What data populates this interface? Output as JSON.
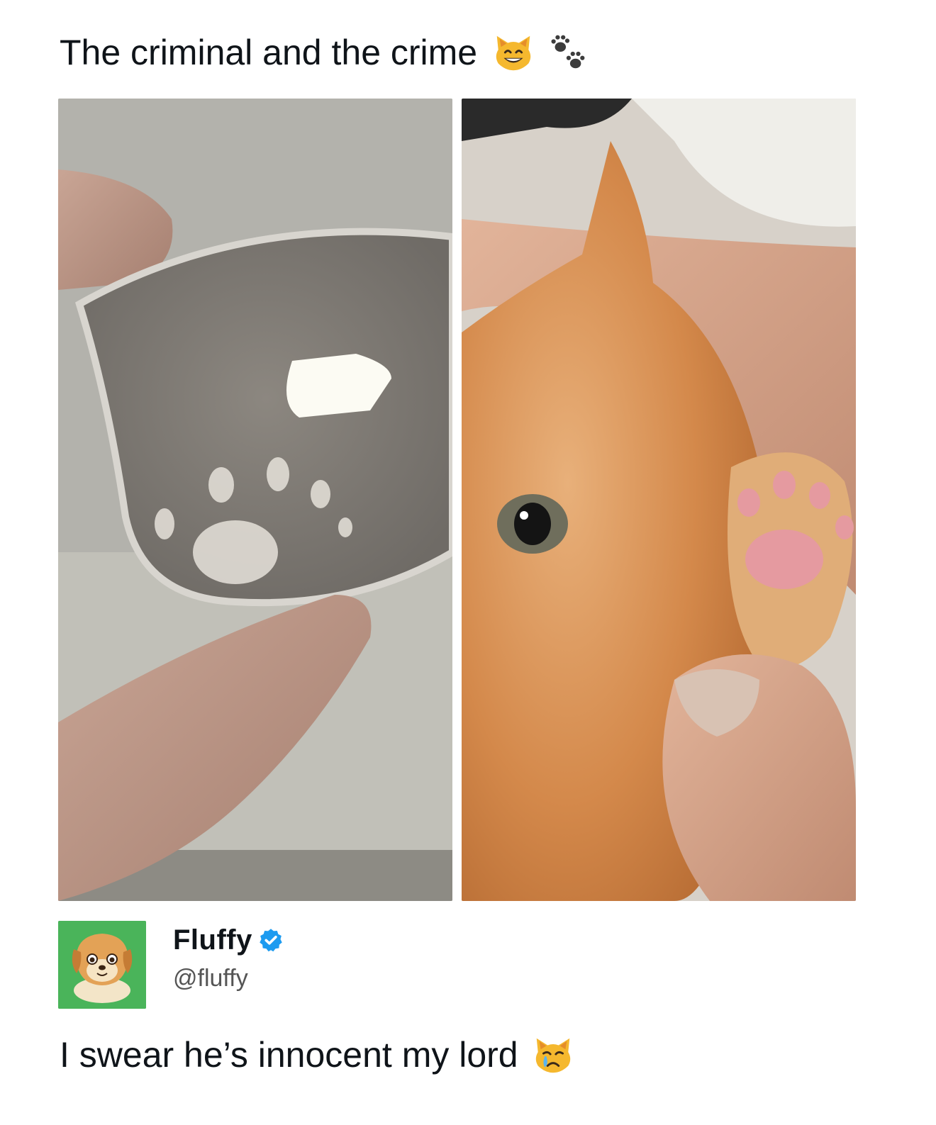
{
  "post": {
    "title": "The criminal and the crime",
    "title_emojis": [
      "grinning-cat-emoji",
      "paw-prints-emoji"
    ],
    "images": [
      {
        "name": "glasses-with-paw-print-photo"
      },
      {
        "name": "orange-kitten-paw-photo"
      }
    ],
    "caption": "I swear he’s innocent my lord",
    "caption_emoji": "crying-cat-emoji"
  },
  "author": {
    "name": "Fluffy",
    "handle": "@fluffy",
    "verified_icon": "verified-badge-icon",
    "avatar_bg": "#4ab45a"
  },
  "colors": {
    "verified_blue": "#1d9bf0",
    "text_primary": "#0f1419",
    "text_secondary": "#555555"
  }
}
